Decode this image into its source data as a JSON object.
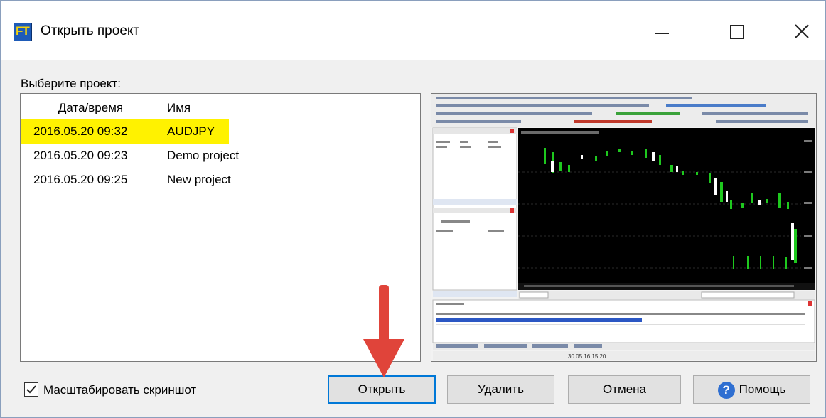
{
  "window": {
    "title": "Открыть проект",
    "app_icon_text": "FT"
  },
  "prompt_label": "Выберите проект:",
  "table": {
    "columns": [
      "Дата/время",
      "Имя"
    ],
    "rows": [
      {
        "datetime": "2016.05.20 09:32",
        "name": "AUDJPY",
        "selected": true
      },
      {
        "datetime": "2016.05.20 09:23",
        "name": "Demo project",
        "selected": false
      },
      {
        "datetime": "2016.05.20 09:25",
        "name": "New project",
        "selected": false
      }
    ]
  },
  "preview": {
    "status_text": "30.05.16 15:20"
  },
  "scale_checkbox": {
    "label": "Масштабировать скриншот",
    "checked": true
  },
  "buttons": {
    "open": "Открыть",
    "delete": "Удалить",
    "cancel": "Отмена",
    "help": "Помощь"
  },
  "colors": {
    "selection": "#fff200",
    "arrow": "#e0443a",
    "focus": "#0078d7"
  }
}
